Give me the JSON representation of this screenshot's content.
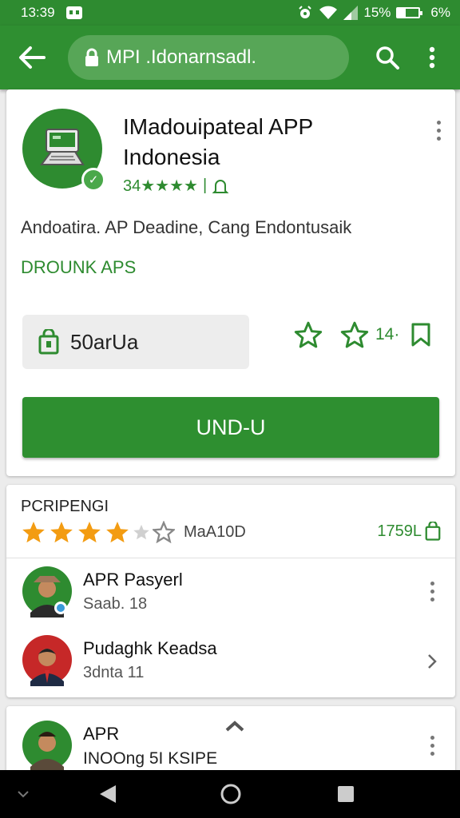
{
  "status_bar": {
    "time": "13:39",
    "battery_text": "15%",
    "signal_text": "6%",
    "icons": [
      "notification-icon",
      "alarm-icon",
      "wifi-icon",
      "signal-icon",
      "battery-icon"
    ]
  },
  "toolbar": {
    "url": "MPI .Idonarnsadl.",
    "icons": [
      "back-arrow-icon",
      "lock-icon",
      "search-icon",
      "overflow-menu-icon"
    ]
  },
  "app": {
    "title_line1": "IMadouipateal APP",
    "title_line2": "Indonesia",
    "rating_text": "34★★★★",
    "description": "Andoatira. AP Deadine, Cang Endontusaik",
    "developer": "DROUNK APS",
    "price_label": "50arUa",
    "count_text": "14·",
    "install_label": "UND-U"
  },
  "reviews": {
    "header": "PCRIPENGI",
    "star_rating": 4,
    "count_text": "MaA10D",
    "side_text": "1759L",
    "items": [
      {
        "name": "APR Pasyerl",
        "date": "Saab. 18"
      },
      {
        "name": "Pudaghk Keadsa",
        "date": "3dnta 11"
      }
    ],
    "peek": {
      "name": "APR",
      "subtitle": "INOOng 5I KSIPE"
    }
  },
  "colors": {
    "brand_green": "#2e8b30",
    "url_bar": "#57a657",
    "star_orange": "#f39c12",
    "nav_black": "#000000"
  },
  "nav_icons": [
    "collapse-icon",
    "back-triangle-icon",
    "home-circle-icon",
    "recents-square-icon"
  ]
}
